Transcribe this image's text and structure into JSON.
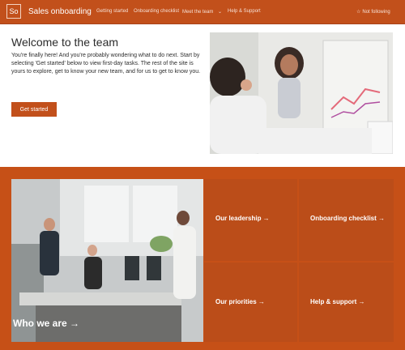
{
  "header": {
    "logo_text": "So",
    "site_title": "Sales onboarding",
    "nav": [
      "Getting started",
      "Onboarding checklist",
      "Meet the team",
      "Help & Support"
    ],
    "follow_label": "Not following"
  },
  "hero": {
    "title": "Welcome to the team",
    "body": "You're finally here! And you're probably wondering what to do next. Start by selecting 'Get started' below to view first-day tasks. The rest of the site is yours to explore, get to know your new team, and for us to get to know you.",
    "cta_label": "Get started"
  },
  "tiles": {
    "who_we_are": "Who we are →",
    "leadership": "Our leadership →",
    "onboarding_checklist": "Onboarding checklist →",
    "priorities": "Our priorities →",
    "help_support": "Help & support →"
  },
  "colors": {
    "brand": "#c2501b",
    "tile": "#bb4d19",
    "background": "#c65017"
  }
}
